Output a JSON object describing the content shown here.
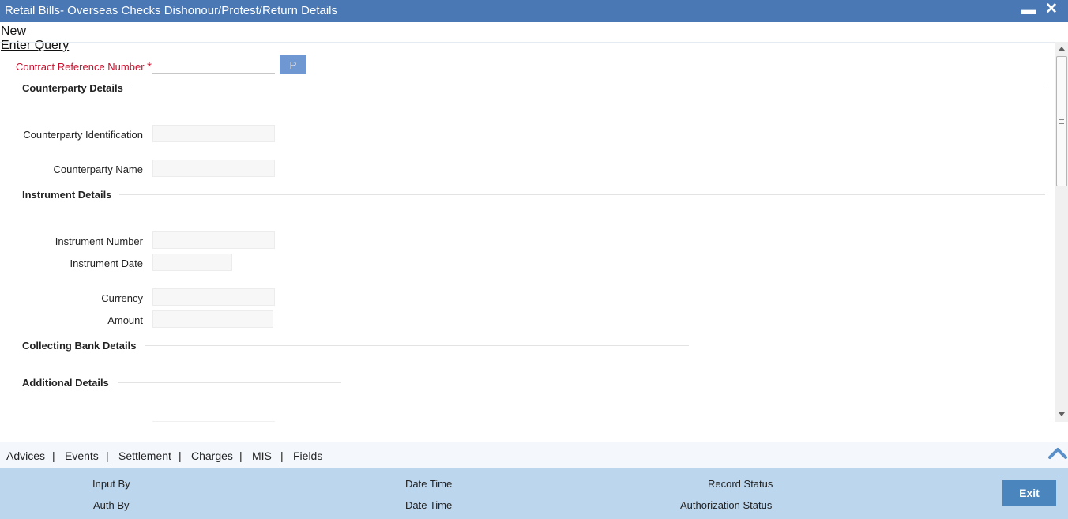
{
  "window": {
    "title": "Retail Bills- Overseas Checks Dishonour/Protest/Return Details",
    "minimize_glyph": "▬",
    "close_glyph": "✕"
  },
  "menu": {
    "new": "New",
    "enter_query": "Enter Query"
  },
  "form": {
    "contract_reference": {
      "label": "Contract Reference Number",
      "required_mark": "*",
      "value": "",
      "button": "P"
    },
    "sections": {
      "counterparty": "Counterparty Details",
      "instrument": "Instrument Details",
      "collecting_bank": "Collecting Bank Details",
      "additional": "Additional Details"
    },
    "counterparty_identification": {
      "label": "Counterparty Identification",
      "value": ""
    },
    "counterparty_name": {
      "label": "Counterparty Name",
      "value": ""
    },
    "instrument_number": {
      "label": "Instrument Number",
      "value": ""
    },
    "instrument_date": {
      "label": "Instrument Date",
      "value": ""
    },
    "currency": {
      "label": "Currency",
      "value": ""
    },
    "amount": {
      "label": "Amount",
      "value": ""
    }
  },
  "tabs": [
    "Advices",
    "Events",
    "Settlement",
    "Charges",
    "MIS",
    "Fields"
  ],
  "tab_separator": "|",
  "footer": {
    "input_by": "Input By",
    "auth_by": "Auth By",
    "date_time_1": "Date Time",
    "date_time_2": "Date Time",
    "record_status": "Record Status",
    "authorization_status": "Authorization Status",
    "exit": "Exit"
  },
  "colors": {
    "titlebar": "#4a78b4",
    "required_label": "#c8102e",
    "p_button": "#6f98d2",
    "footer_bg": "#bcd6ee",
    "exit_button": "#4a86bd"
  },
  "icons": {
    "collapse": "chevron-up-icon"
  }
}
